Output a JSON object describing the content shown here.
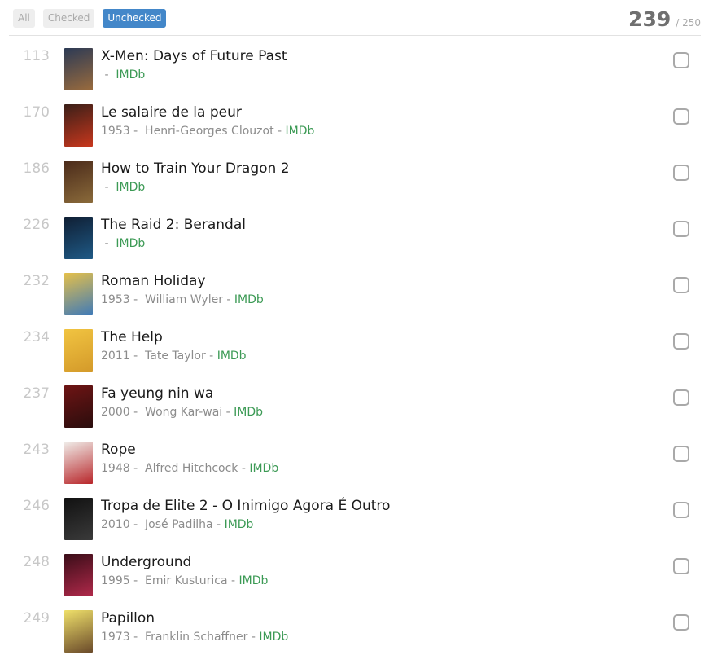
{
  "header": {
    "filters": [
      {
        "label": "All"
      },
      {
        "label": "Checked"
      },
      {
        "label": "Unchecked"
      }
    ],
    "active_filter": "Unchecked",
    "count": "239",
    "total": "/ 250"
  },
  "movies": [
    {
      "rank": "113",
      "title": "X-Men: Days of Future Past",
      "year": "",
      "director": "",
      "imdb": "IMDb",
      "poster_colors": [
        "#2c3a55",
        "#9a6b3d"
      ]
    },
    {
      "rank": "170",
      "title": "Le salaire de la peur",
      "year": "1953",
      "director": "Henri-Georges Clouzot",
      "imdb": "IMDb",
      "poster_colors": [
        "#3a1f18",
        "#c8371d"
      ]
    },
    {
      "rank": "186",
      "title": "How to Train Your Dragon 2",
      "year": "",
      "director": "",
      "imdb": "IMDb",
      "poster_colors": [
        "#4a2a1a",
        "#8a6a3a"
      ]
    },
    {
      "rank": "226",
      "title": "The Raid 2: Berandal",
      "year": "",
      "director": "",
      "imdb": "IMDb",
      "poster_colors": [
        "#0f1e33",
        "#1f5a86"
      ]
    },
    {
      "rank": "232",
      "title": "Roman Holiday",
      "year": "1953",
      "director": "William Wyler",
      "imdb": "IMDb",
      "poster_colors": [
        "#e5c04a",
        "#3f7ab8"
      ]
    },
    {
      "rank": "234",
      "title": "The Help",
      "year": "2011",
      "director": "Tate Taylor",
      "imdb": "IMDb",
      "poster_colors": [
        "#f1c441",
        "#d49a2a"
      ]
    },
    {
      "rank": "237",
      "title": "Fa yeung nin wa",
      "year": "2000",
      "director": "Wong Kar-wai",
      "imdb": "IMDb",
      "poster_colors": [
        "#6e1414",
        "#2a0d0d"
      ]
    },
    {
      "rank": "243",
      "title": "Rope",
      "year": "1948",
      "director": "Alfred Hitchcock",
      "imdb": "IMDb",
      "poster_colors": [
        "#f0eeea",
        "#b8262a"
      ]
    },
    {
      "rank": "246",
      "title": "Tropa de Elite 2 - O Inimigo Agora É Outro",
      "year": "2010",
      "director": "José Padilha",
      "imdb": "IMDb",
      "poster_colors": [
        "#111111",
        "#3a3a3a"
      ]
    },
    {
      "rank": "248",
      "title": "Underground",
      "year": "1995",
      "director": "Emir Kusturica",
      "imdb": "IMDb",
      "poster_colors": [
        "#3a0d18",
        "#b0294a"
      ]
    },
    {
      "rank": "249",
      "title": "Papillon",
      "year": "1973",
      "director": "Franklin Schaffner",
      "imdb": "IMDb",
      "poster_colors": [
        "#efe06a",
        "#6a4a2a"
      ]
    }
  ]
}
